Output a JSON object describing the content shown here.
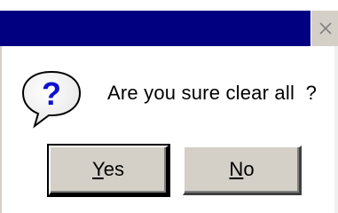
{
  "dialog": {
    "close_glyph": "×",
    "message": "Are you sure clear all  ?",
    "icon": "question-icon",
    "icon_symbol": "?",
    "buttons": {
      "yes_label": "Yes",
      "yes_access_key": "Y",
      "yes_rest": "es",
      "no_label": "No",
      "no_access_key": "N",
      "no_rest": "o"
    }
  },
  "colors": {
    "titlebar": "#000080",
    "button_face": "#d4d0c8",
    "icon_blue": "#1010d0"
  }
}
